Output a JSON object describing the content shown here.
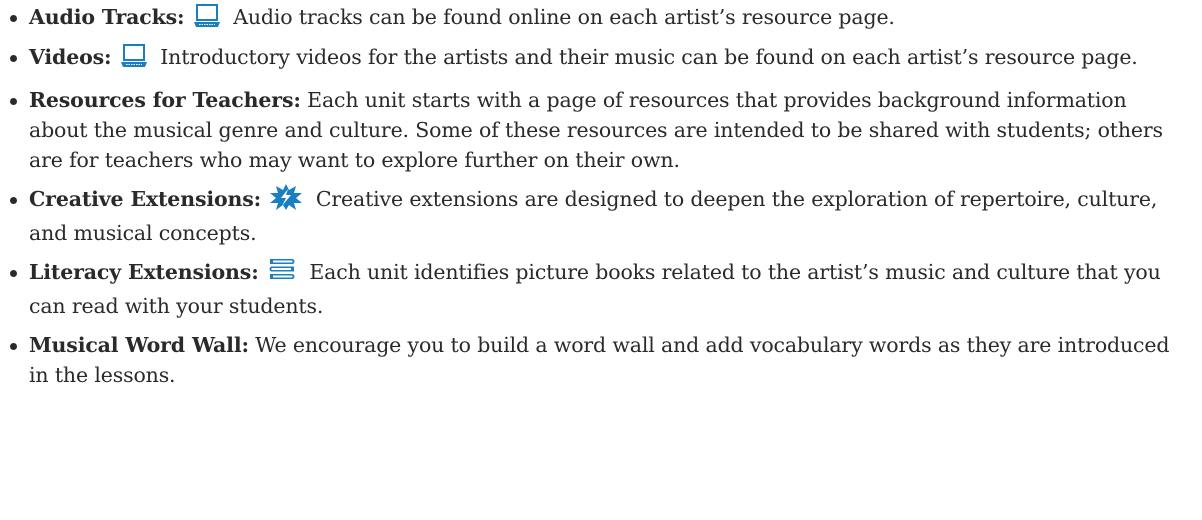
{
  "items": [
    {
      "label": "Audio Tracks:",
      "icon": "laptop-icon",
      "text": "Audio tracks can be found online on each artist’s resource page."
    },
    {
      "label": "Videos:",
      "icon": "laptop-icon",
      "text": "Introductory videos for the artists and their music can be found on each artist’s resource page."
    },
    {
      "label": "Resources for Teachers:",
      "icon": "",
      "text": "Each unit starts with a page of resources that provides background information about the musical genre and culture. Some of these resources are intended to be shared with students; others are for teachers who may want to explore further on their own."
    },
    {
      "label": "Creative Extensions:",
      "icon": "lightning-burst-icon",
      "text": "Creative extensions are designed to deepen the exploration of repertoire, culture, and musical concepts."
    },
    {
      "label": "Literacy Extensions:",
      "icon": "books-icon",
      "text": "Each unit identifies picture books related to the artist’s music and culture that you can read with your students."
    },
    {
      "label": "Musical Word Wall:",
      "icon": "",
      "text": "We encourage you to build a word wall and add vocabulary words as they are introduced in the lessons."
    }
  ],
  "colors": {
    "icon_blue": "#1a7fc1",
    "text": "#2a2a2a"
  }
}
